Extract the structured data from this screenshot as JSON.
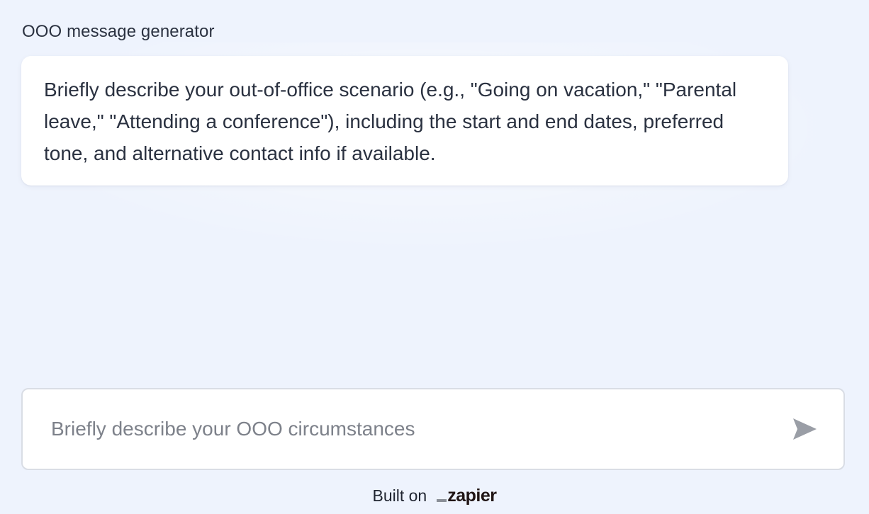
{
  "chat": {
    "title": "OOO message generator",
    "message": "Briefly describe your out-of-office scenario (e.g., \"Going on vacation,\" \"Parental leave,\" \"Attending a conference\"), including the start and end dates, preferred tone, and alternative contact info if available."
  },
  "composer": {
    "placeholder": "Briefly describe your OOO circumstances",
    "value": "",
    "send_icon": "send-icon"
  },
  "footer": {
    "built_on": "Built on",
    "brand": "zapier"
  },
  "colors": {
    "background": "#eef3fd",
    "bubble": "#ffffff",
    "text": "#2a3140",
    "placeholder": "#7d818a",
    "send_icon": "#9a9ea6"
  }
}
